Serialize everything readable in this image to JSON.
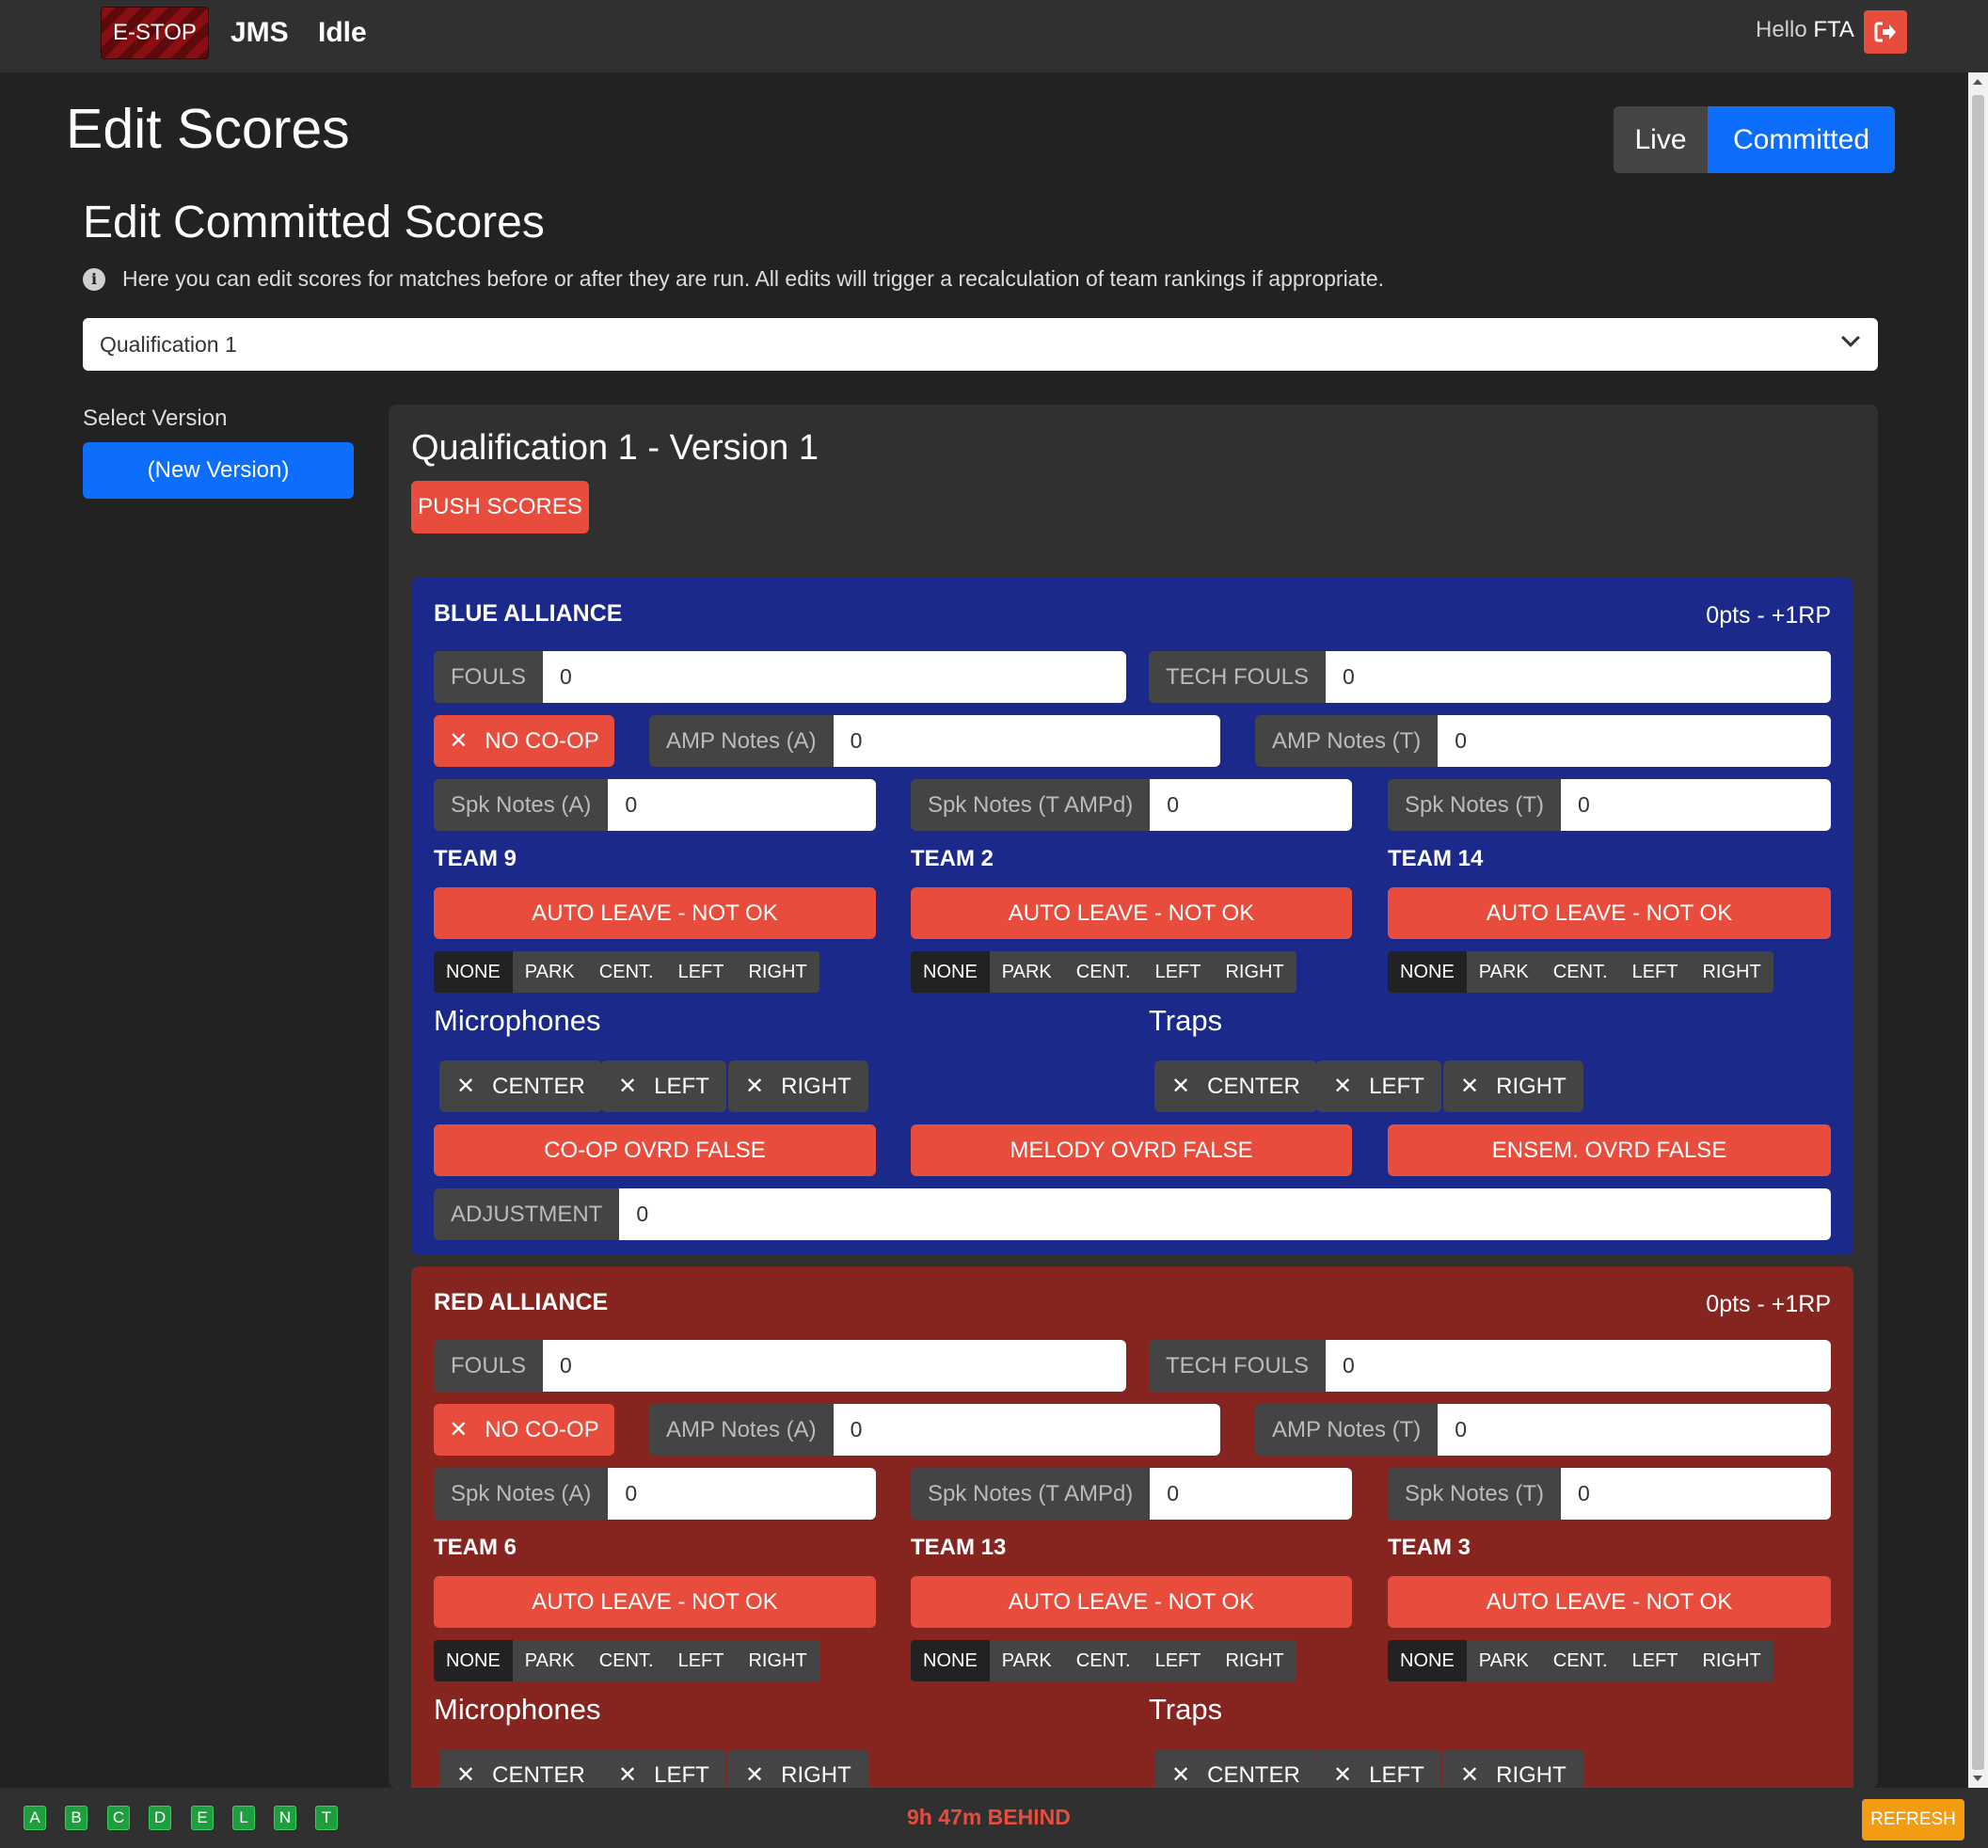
{
  "navbar": {
    "estop": "E-STOP",
    "brand": "JMS",
    "status": "Idle",
    "hello": "Hello",
    "user": "FTA"
  },
  "page": {
    "title": "Edit Scores",
    "toggle_live": "Live",
    "toggle_committed": "Committed",
    "subtitle": "Edit Committed Scores",
    "info": "Here you can edit scores for matches before or after they are run. All edits will trigger a recalculation of team rankings if appropriate.",
    "match_select": "Qualification 1",
    "select_version_label": "Select Version",
    "new_version": "(New Version)"
  },
  "panel": {
    "title": "Qualification 1 - Version 1",
    "push": "PUSH SCORES"
  },
  "labels": {
    "fouls": "FOULS",
    "tech_fouls": "TECH FOULS",
    "no_coop": "NO CO-OP",
    "amp_a": "AMP Notes (A)",
    "amp_t": "AMP Notes (T)",
    "spk_a": "Spk Notes (A)",
    "spk_t_ampd": "Spk Notes (T AMPd)",
    "spk_t": "Spk Notes (T)",
    "auto_leave": "AUTO LEAVE - NOT OK",
    "endgame": [
      "NONE",
      "PARK",
      "CENT.",
      "LEFT",
      "RIGHT"
    ],
    "microphones": "Microphones",
    "traps": "Traps",
    "center": "CENTER",
    "left": "LEFT",
    "right": "RIGHT",
    "coop_ovrd": "CO-OP OVRD FALSE",
    "melody_ovrd": "MELODY OVRD FALSE",
    "ensem_ovrd": "ENSEM. OVRD FALSE",
    "adjustment": "ADJUSTMENT",
    "x": "✕"
  },
  "blue": {
    "title": "BLUE ALLIANCE",
    "points": "0pts - +1RP",
    "fouls": "0",
    "tech_fouls": "0",
    "amp_a": "0",
    "amp_t": "0",
    "spk_a": "0",
    "spk_t_ampd": "0",
    "spk_t": "0",
    "adjustment": "0",
    "teams": [
      "TEAM 9",
      "TEAM 2",
      "TEAM 14"
    ],
    "endgame_selected": [
      "NONE",
      "NONE",
      "NONE"
    ]
  },
  "red": {
    "title": "RED ALLIANCE",
    "points": "0pts - +1RP",
    "fouls": "0",
    "tech_fouls": "0",
    "amp_a": "0",
    "amp_t": "0",
    "spk_a": "0",
    "spk_t_ampd": "0",
    "spk_t": "0",
    "teams": [
      "TEAM 6",
      "TEAM 13",
      "TEAM 3"
    ],
    "endgame_selected": [
      "NONE",
      "NONE",
      "NONE"
    ]
  },
  "footer": {
    "ds_indicators": [
      "A",
      "B",
      "C",
      "D",
      "E",
      "L",
      "N",
      "T"
    ],
    "behind": "9h 47m BEHIND",
    "refresh": "REFRESH"
  },
  "colors": {
    "blue_alliance": "#1b2a8a",
    "red_alliance": "#862420",
    "accent": "#0d6efd",
    "danger": "#e74c3c",
    "warning": "#f39c12",
    "ds_ok": "#1e9e3e"
  },
  "icons": [
    "logout-icon",
    "info-icon",
    "chevron-down-icon",
    "close-icon"
  ]
}
